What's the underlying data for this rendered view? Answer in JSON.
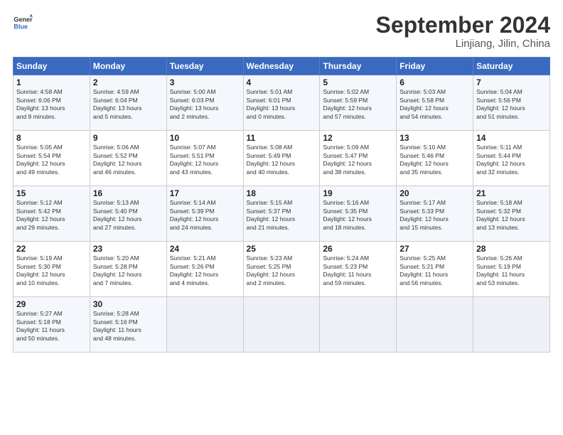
{
  "header": {
    "logo_line1": "General",
    "logo_line2": "Blue",
    "month": "September 2024",
    "location": "Linjiang, Jilin, China"
  },
  "weekdays": [
    "Sunday",
    "Monday",
    "Tuesday",
    "Wednesday",
    "Thursday",
    "Friday",
    "Saturday"
  ],
  "weeks": [
    [
      {
        "day": "1",
        "info": "Sunrise: 4:58 AM\nSunset: 6:06 PM\nDaylight: 13 hours\nand 8 minutes."
      },
      {
        "day": "2",
        "info": "Sunrise: 4:59 AM\nSunset: 6:04 PM\nDaylight: 13 hours\nand 5 minutes."
      },
      {
        "day": "3",
        "info": "Sunrise: 5:00 AM\nSunset: 6:03 PM\nDaylight: 13 hours\nand 2 minutes."
      },
      {
        "day": "4",
        "info": "Sunrise: 5:01 AM\nSunset: 6:01 PM\nDaylight: 13 hours\nand 0 minutes."
      },
      {
        "day": "5",
        "info": "Sunrise: 5:02 AM\nSunset: 5:59 PM\nDaylight: 12 hours\nand 57 minutes."
      },
      {
        "day": "6",
        "info": "Sunrise: 5:03 AM\nSunset: 5:58 PM\nDaylight: 12 hours\nand 54 minutes."
      },
      {
        "day": "7",
        "info": "Sunrise: 5:04 AM\nSunset: 5:56 PM\nDaylight: 12 hours\nand 51 minutes."
      }
    ],
    [
      {
        "day": "8",
        "info": "Sunrise: 5:05 AM\nSunset: 5:54 PM\nDaylight: 12 hours\nand 49 minutes."
      },
      {
        "day": "9",
        "info": "Sunrise: 5:06 AM\nSunset: 5:52 PM\nDaylight: 12 hours\nand 46 minutes."
      },
      {
        "day": "10",
        "info": "Sunrise: 5:07 AM\nSunset: 5:51 PM\nDaylight: 12 hours\nand 43 minutes."
      },
      {
        "day": "11",
        "info": "Sunrise: 5:08 AM\nSunset: 5:49 PM\nDaylight: 12 hours\nand 40 minutes."
      },
      {
        "day": "12",
        "info": "Sunrise: 5:09 AM\nSunset: 5:47 PM\nDaylight: 12 hours\nand 38 minutes."
      },
      {
        "day": "13",
        "info": "Sunrise: 5:10 AM\nSunset: 5:46 PM\nDaylight: 12 hours\nand 35 minutes."
      },
      {
        "day": "14",
        "info": "Sunrise: 5:11 AM\nSunset: 5:44 PM\nDaylight: 12 hours\nand 32 minutes."
      }
    ],
    [
      {
        "day": "15",
        "info": "Sunrise: 5:12 AM\nSunset: 5:42 PM\nDaylight: 12 hours\nand 29 minutes."
      },
      {
        "day": "16",
        "info": "Sunrise: 5:13 AM\nSunset: 5:40 PM\nDaylight: 12 hours\nand 27 minutes."
      },
      {
        "day": "17",
        "info": "Sunrise: 5:14 AM\nSunset: 5:39 PM\nDaylight: 12 hours\nand 24 minutes."
      },
      {
        "day": "18",
        "info": "Sunrise: 5:15 AM\nSunset: 5:37 PM\nDaylight: 12 hours\nand 21 minutes."
      },
      {
        "day": "19",
        "info": "Sunrise: 5:16 AM\nSunset: 5:35 PM\nDaylight: 12 hours\nand 18 minutes."
      },
      {
        "day": "20",
        "info": "Sunrise: 5:17 AM\nSunset: 5:33 PM\nDaylight: 12 hours\nand 15 minutes."
      },
      {
        "day": "21",
        "info": "Sunrise: 5:18 AM\nSunset: 5:32 PM\nDaylight: 12 hours\nand 13 minutes."
      }
    ],
    [
      {
        "day": "22",
        "info": "Sunrise: 5:19 AM\nSunset: 5:30 PM\nDaylight: 12 hours\nand 10 minutes."
      },
      {
        "day": "23",
        "info": "Sunrise: 5:20 AM\nSunset: 5:28 PM\nDaylight: 12 hours\nand 7 minutes."
      },
      {
        "day": "24",
        "info": "Sunrise: 5:21 AM\nSunset: 5:26 PM\nDaylight: 12 hours\nand 4 minutes."
      },
      {
        "day": "25",
        "info": "Sunrise: 5:23 AM\nSunset: 5:25 PM\nDaylight: 12 hours\nand 2 minutes."
      },
      {
        "day": "26",
        "info": "Sunrise: 5:24 AM\nSunset: 5:23 PM\nDaylight: 11 hours\nand 59 minutes."
      },
      {
        "day": "27",
        "info": "Sunrise: 5:25 AM\nSunset: 5:21 PM\nDaylight: 11 hours\nand 56 minutes."
      },
      {
        "day": "28",
        "info": "Sunrise: 5:26 AM\nSunset: 5:19 PM\nDaylight: 11 hours\nand 53 minutes."
      }
    ],
    [
      {
        "day": "29",
        "info": "Sunrise: 5:27 AM\nSunset: 5:18 PM\nDaylight: 11 hours\nand 50 minutes."
      },
      {
        "day": "30",
        "info": "Sunrise: 5:28 AM\nSunset: 5:16 PM\nDaylight: 11 hours\nand 48 minutes."
      },
      {
        "day": "",
        "info": ""
      },
      {
        "day": "",
        "info": ""
      },
      {
        "day": "",
        "info": ""
      },
      {
        "day": "",
        "info": ""
      },
      {
        "day": "",
        "info": ""
      }
    ]
  ]
}
